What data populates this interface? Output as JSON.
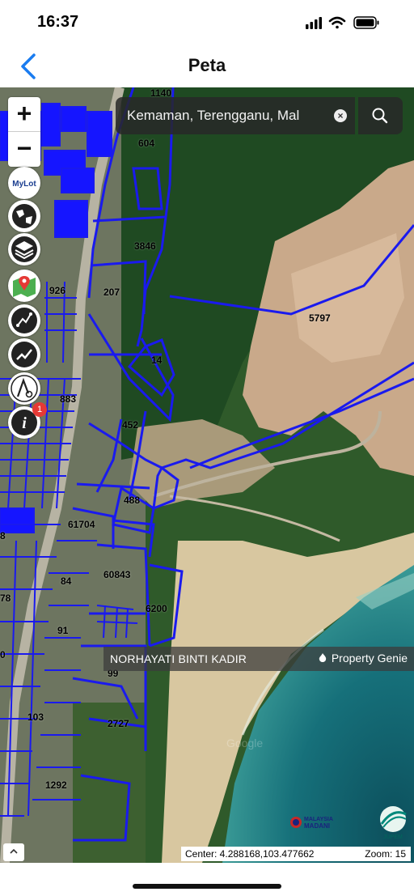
{
  "status_bar": {
    "time": "16:37"
  },
  "nav": {
    "title": "Peta"
  },
  "search": {
    "value": "Kemaman, Terengganu, Mal"
  },
  "zoom": {
    "plus": "+",
    "minus": "−"
  },
  "tools": [
    {
      "name": "mylot-icon",
      "label": "MyLot"
    },
    {
      "name": "globe-icon",
      "label": ""
    },
    {
      "name": "layers-icon",
      "label": ""
    },
    {
      "name": "map-pin-icon",
      "label": ""
    },
    {
      "name": "measure-icon",
      "label": ""
    },
    {
      "name": "route-icon",
      "label": ""
    },
    {
      "name": "search-text-icon",
      "label": ""
    },
    {
      "name": "info-icon",
      "label": "i"
    }
  ],
  "info_badge": "1",
  "lots": [
    {
      "id": "1140"
    },
    {
      "id": "604"
    },
    {
      "id": "3846"
    },
    {
      "id": "926"
    },
    {
      "id": "207"
    },
    {
      "id": "5797"
    },
    {
      "id": "14"
    },
    {
      "id": "883"
    },
    {
      "id": "452"
    },
    {
      "id": "488"
    },
    {
      "id": "61704"
    },
    {
      "id": "8"
    },
    {
      "id": "84"
    },
    {
      "id": "60843"
    },
    {
      "id": "78"
    },
    {
      "id": "6200"
    },
    {
      "id": "91"
    },
    {
      "id": "0"
    },
    {
      "id": "99"
    },
    {
      "id": "103"
    },
    {
      "id": "2727"
    },
    {
      "id": "1292"
    }
  ],
  "owner_bar": {
    "name": "NORHAYATI BINTI KADIR",
    "brand": "Property Genie"
  },
  "watermark": "Google",
  "logos": {
    "malaysia": "MALAYSIA MADANI",
    "jupem": "JUPEM"
  },
  "center_readout": {
    "center": "Center: 4.288168,103.477662",
    "zoom": "Zoom: 15"
  },
  "colors": {
    "parcel_line": "#1a1aee",
    "parcel_fill": "#1515ff",
    "accent": "#1a7cf0"
  }
}
